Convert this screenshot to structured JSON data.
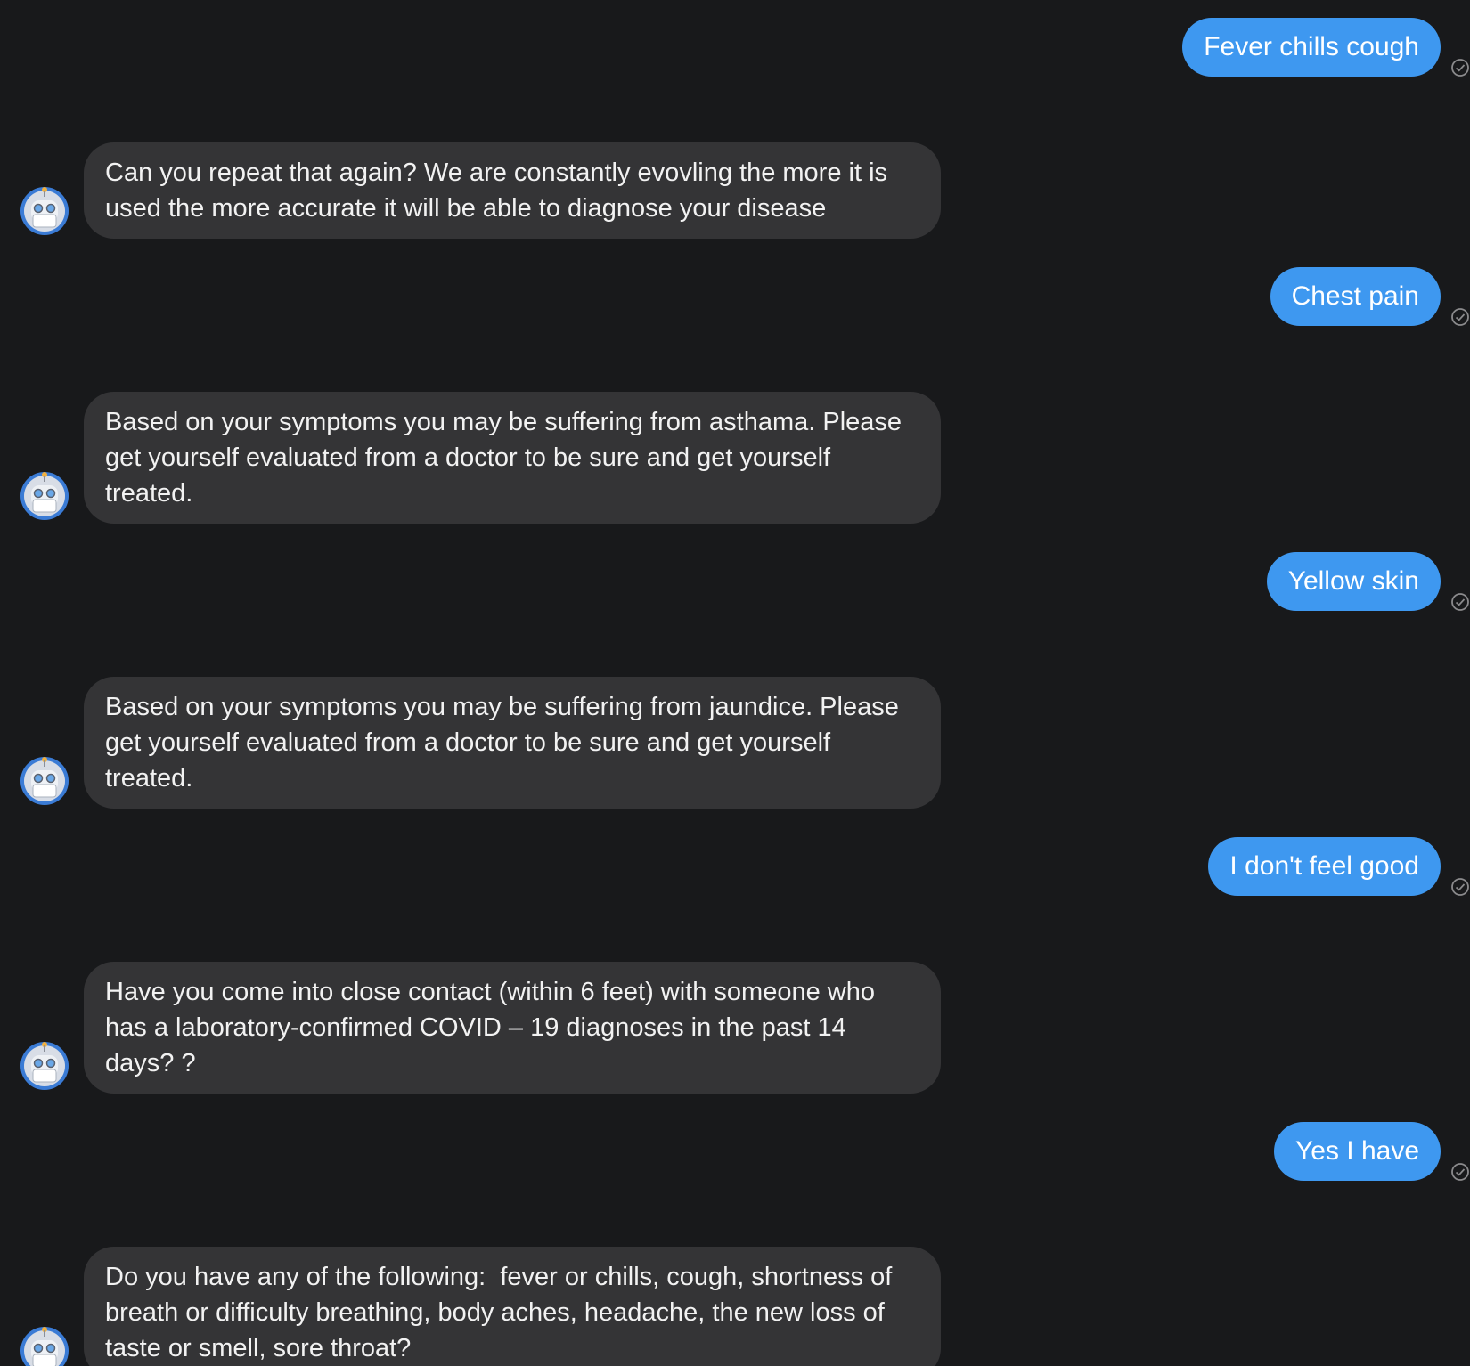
{
  "conversation": {
    "messages": [
      {
        "sender": "user",
        "text": "Fever chills cough",
        "status_icon": "check-circle-icon"
      },
      {
        "sender": "bot",
        "text": "Can you repeat that again? We are constantly evovling the more it is used the more accurate it will be able to diagnose your disease",
        "avatar_icon": "robot-icon"
      },
      {
        "sender": "user",
        "text": "Chest pain",
        "status_icon": "check-circle-icon"
      },
      {
        "sender": "bot",
        "text": "Based on your symptoms you may be suffering from asthama. Please get yourself evaluated from a doctor to be sure and get yourself treated.",
        "avatar_icon": "robot-icon"
      },
      {
        "sender": "user",
        "text": "Yellow skin",
        "status_icon": "check-circle-icon"
      },
      {
        "sender": "bot",
        "text": "Based on your symptoms you may be suffering from jaundice. Please get yourself evaluated from a doctor to be sure and get yourself treated.",
        "avatar_icon": "robot-icon"
      },
      {
        "sender": "user",
        "text": "I don't feel good",
        "status_icon": "check-circle-icon"
      },
      {
        "sender": "bot",
        "text": "Have you come into close contact (within 6 feet) with someone who has a laboratory-confirmed COVID – 19 diagnoses in the past 14 days? ?",
        "avatar_icon": "robot-icon"
      },
      {
        "sender": "user",
        "text": "Yes I have",
        "status_icon": "check-circle-icon"
      },
      {
        "sender": "bot",
        "text": "Do you have any of the following:  fever or chills, cough, shortness of breath or difficulty breathing, body aches, headache, the new loss of taste or smell, sore throat?",
        "avatar_icon": "robot-icon"
      }
    ]
  },
  "colors": {
    "background": "#18191b",
    "user_bubble": "#3e98f0",
    "bot_bubble": "#343436",
    "text": "#ffffff"
  }
}
